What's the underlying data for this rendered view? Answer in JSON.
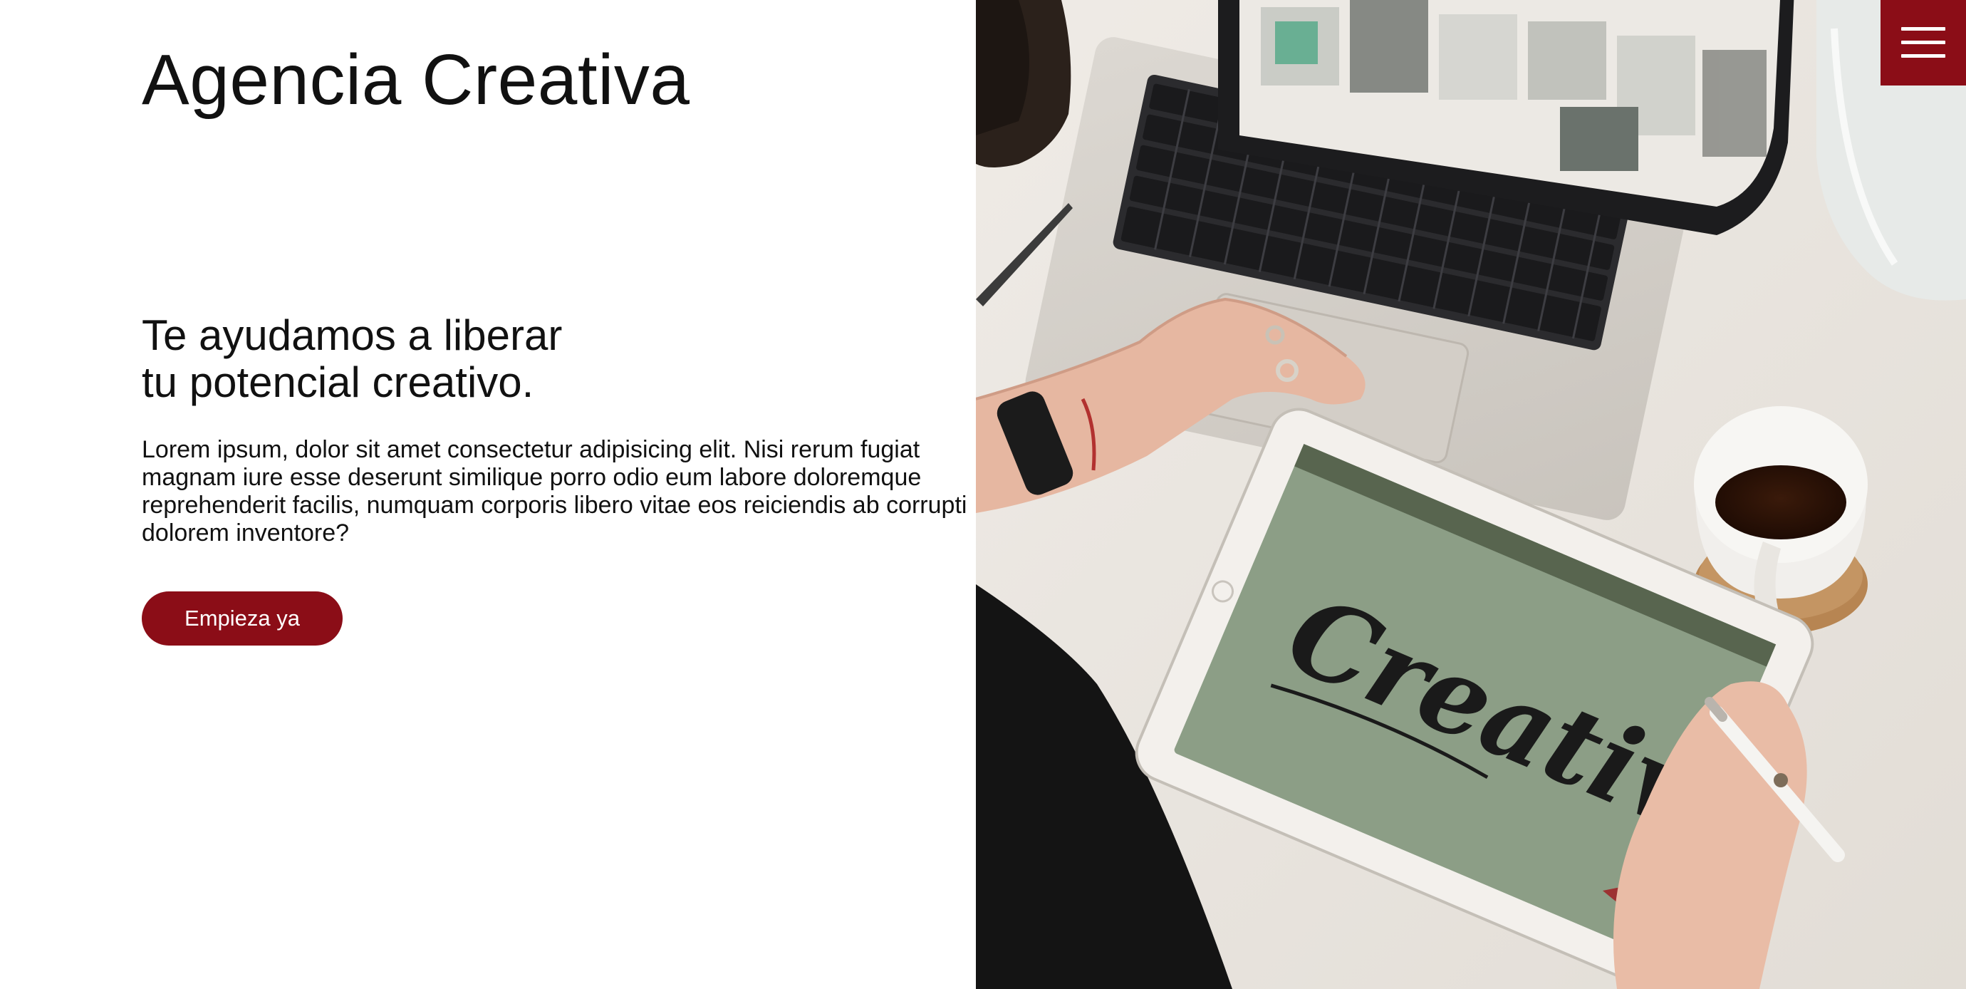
{
  "brand": {
    "name": "Agencia Creativa"
  },
  "hero": {
    "headline_line1": "Te ayudamos a liberar",
    "headline_line2": "tu potencial creativo.",
    "description": "Lorem ipsum, dolor sit amet consectetur adipisicing elit. Nisi rerum fugiat magnam iure esse deserunt similique porro odio eum labore doloremque reprehenderit facilis, numquam corporis libero vitae eos reiciendis ab corrupti dolorem inventore?",
    "cta_label": "Empieza ya"
  },
  "photo": {
    "tablet_text": "Creative"
  },
  "colors": {
    "accent": "#8b0d17",
    "text": "#111111",
    "background": "#ffffff"
  },
  "icons": {
    "menu": "hamburger-menu-icon"
  }
}
